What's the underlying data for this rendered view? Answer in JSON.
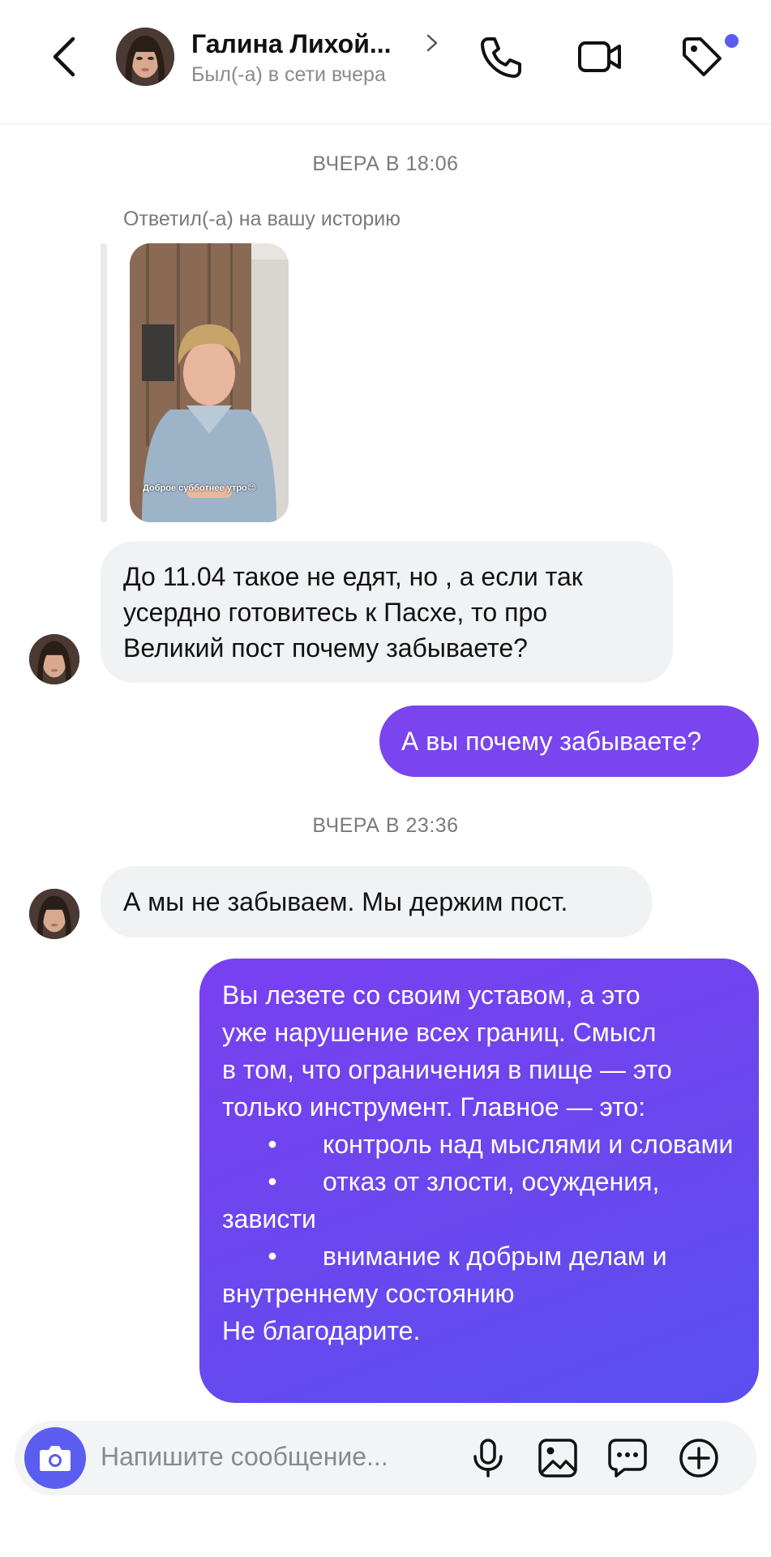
{
  "header": {
    "name": "Галина Лихой...",
    "status": "Был(-а) в сети вчера",
    "accent": "#5b5cf0"
  },
  "icons": {
    "back": "chevron-left-icon",
    "phone": "phone-icon",
    "video": "video-camera-icon",
    "tag": "tag-icon",
    "camera": "camera-icon",
    "mic": "microphone-icon",
    "gallery": "image-icon",
    "sticker": "message-dots-icon",
    "plus": "plus-circle-icon"
  },
  "chat": {
    "stamp1": "ВЧЕРА В 18:06",
    "reply_note": "Ответил(-а) на вашу историю",
    "story_caption": "Доброе субботнее утро😊",
    "msg1": "До 11.04 такое не едят, но , а если так\nусердно готовитесь к Пасхе, то про\nВеликий пост почему  забываете?",
    "msg2": "А вы почему забываете?",
    "stamp2": "ВЧЕРА В 23:36",
    "msg3": "А мы не забываем. Мы держим пост.",
    "msg4": {
      "intro": "Вы лезете со своим уставом, а это\nуже  нарушение всех границ. Смысл\nв том, что ограничения в пище — это\nтолько инструмент. Главное — это:",
      "bullet": "•",
      "items": [
        "контроль над мыслями и словами",
        "отказ от злости, осуждения, зависти",
        "внимание к добрым делам и внутреннему состоянию"
      ],
      "outro": "Не благодарите."
    },
    "out_color": "#7a45ef"
  },
  "composer": {
    "placeholder": "Напишите сообщение..."
  }
}
